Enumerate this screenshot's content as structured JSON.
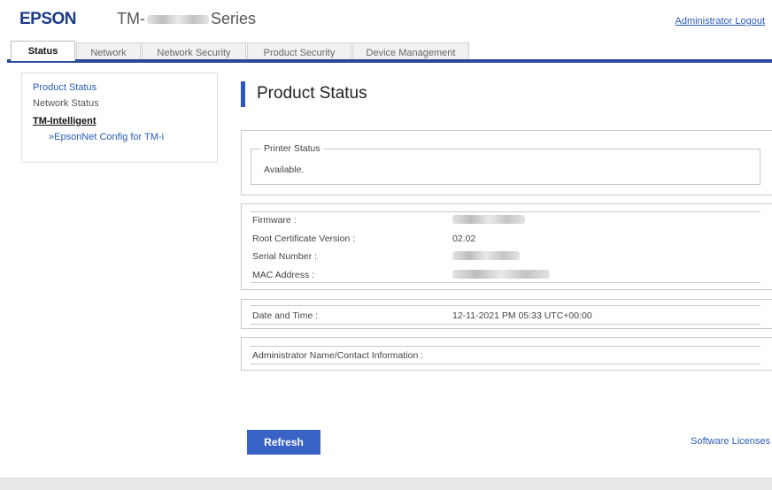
{
  "header": {
    "logo": "EPSON",
    "model_prefix": "TM-",
    "model_suffix": "Series",
    "admin_logout": "Administrator Logout"
  },
  "tabs": [
    {
      "label": "Status",
      "active": true
    },
    {
      "label": "Network",
      "active": false
    },
    {
      "label": "Network Security",
      "active": false
    },
    {
      "label": "Product Security",
      "active": false
    },
    {
      "label": "Device Management",
      "active": false
    }
  ],
  "sidebar": {
    "product_status": "Product Status",
    "network_status": "Network Status",
    "tm_intelligent": "TM-Intelligent",
    "epsonnet_config": "»EpsonNet Config for TM-i"
  },
  "page_title": "Product Status",
  "printer_status": {
    "legend": "Printer Status",
    "value": "Available."
  },
  "info": {
    "firmware_label": "Firmware :",
    "root_cert_label": "Root Certificate Version :",
    "root_cert_value": "02.02",
    "serial_label": "Serial Number :",
    "mac_label": "MAC Address :"
  },
  "datetime": {
    "label": "Date and Time :",
    "value": "12-11-2021 PM 05:33 UTC+00:00"
  },
  "admin": {
    "label": "Administrator Name/Contact Information :"
  },
  "buttons": {
    "refresh": "Refresh"
  },
  "footer": {
    "software_licenses": "Software Licenses"
  },
  "colors": {
    "brand": "#1a3a8c",
    "accent": "#3a63c8",
    "link": "#2a5bb8"
  }
}
